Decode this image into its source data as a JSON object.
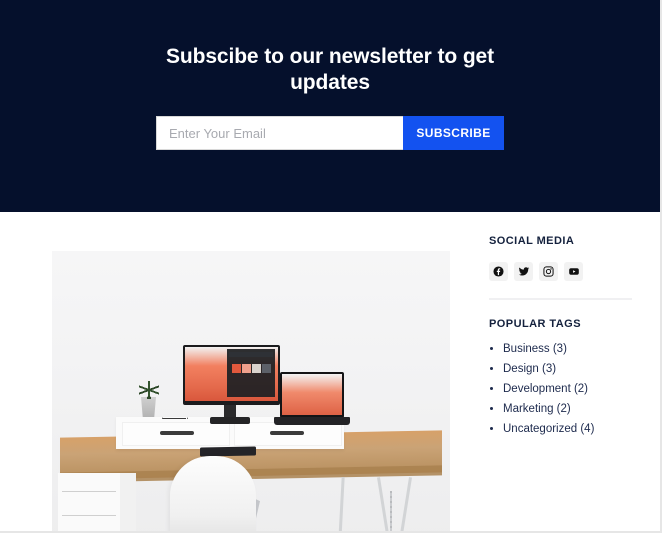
{
  "newsletter": {
    "title": "Subscibe to our newsletter to get updates",
    "email_placeholder": "Enter Your Email",
    "email_value": "",
    "subscribe_label": "SUBSCRIBE",
    "background_color": "#05102c",
    "button_color": "#1352f0"
  },
  "featured": {
    "alt": "white desk with monitor, laptop, keyboard, plant and white chair"
  },
  "sidebar": {
    "social": {
      "title": "SOCIAL MEDIA",
      "items": [
        {
          "name": "facebook-icon"
        },
        {
          "name": "twitter-icon"
        },
        {
          "name": "instagram-icon"
        },
        {
          "name": "youtube-icon"
        }
      ]
    },
    "tags": {
      "title": "POPULAR TAGS",
      "items": [
        "Business (3)",
        "Design (3)",
        "Development (2)",
        "Marketing (2)",
        "Uncategorized (4)"
      ]
    }
  }
}
